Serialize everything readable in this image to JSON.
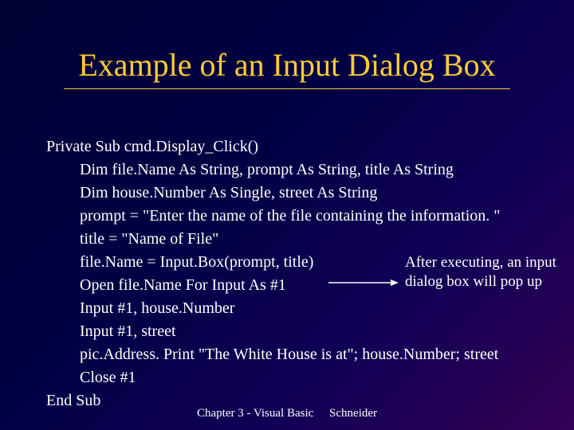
{
  "title": "Example of an Input Dialog Box",
  "code": {
    "l0": "Private Sub cmd.Display_Click()",
    "l1": "Dim file.Name As String, prompt As String, title As String",
    "l2": "Dim house.Number As Single, street As String",
    "l3": "prompt = \"Enter the name of the file containing the information. \"",
    "l4": "title = \"Name of File\"",
    "l5": "file.Name = Input.Box(prompt, title)",
    "l6": "Open file.Name For Input As #1",
    "l7": "Input #1, house.Number",
    "l8": "Input #1, street",
    "l9": "pic.Address. Print \"The White House is at\"; house.Number; street",
    "l10": "Close #1",
    "l11": "End Sub"
  },
  "annotation": {
    "line1": "After executing, an input",
    "line2": "dialog box will pop up"
  },
  "footer": {
    "left": "Chapter 3 - Visual Basic",
    "right": "Schneider"
  }
}
